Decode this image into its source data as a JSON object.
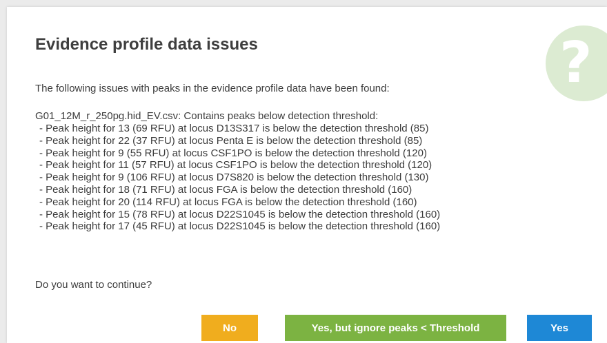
{
  "dialog": {
    "title": "Evidence profile data issues",
    "intro": "The following issues with peaks in the evidence profile data have been found:",
    "file_line": "G01_12M_r_250pg.hid_EV.csv: Contains peaks below detection threshold:",
    "issues": [
      "- Peak height for 13 (69 RFU) at locus D13S317 is below the detection threshold (85)",
      "- Peak height for 22 (37 RFU) at locus Penta E is below the detection threshold (85)",
      "- Peak height for 9 (55 RFU) at locus CSF1PO is below the detection threshold (120)",
      "- Peak height for 11 (57 RFU) at locus CSF1PO is below the detection threshold (120)",
      "- Peak height for 9 (106 RFU) at locus D7S820 is below the detection threshold (130)",
      "- Peak height for 18 (71 RFU) at locus FGA is below the detection threshold (160)",
      "- Peak height for 20 (114 RFU) at locus FGA is below the detection threshold (160)",
      "- Peak height for 15 (78 RFU) at locus D22S1045 is below the detection threshold (160)",
      "- Peak height for 17 (45 RFU) at locus D22S1045 is below the detection threshold (160)"
    ],
    "question": "Do you want to continue?",
    "help_icon": "question-mark-icon",
    "buttons": {
      "no": "No",
      "ignore": "Yes, but ignore peaks < Threshold",
      "yes": "Yes"
    }
  },
  "colors": {
    "no_button": "#f0ad1e",
    "ignore_button": "#7cb342",
    "yes_button": "#1e88d6",
    "help_badge": "#dcebd2",
    "title_text": "#3e3e3e"
  }
}
